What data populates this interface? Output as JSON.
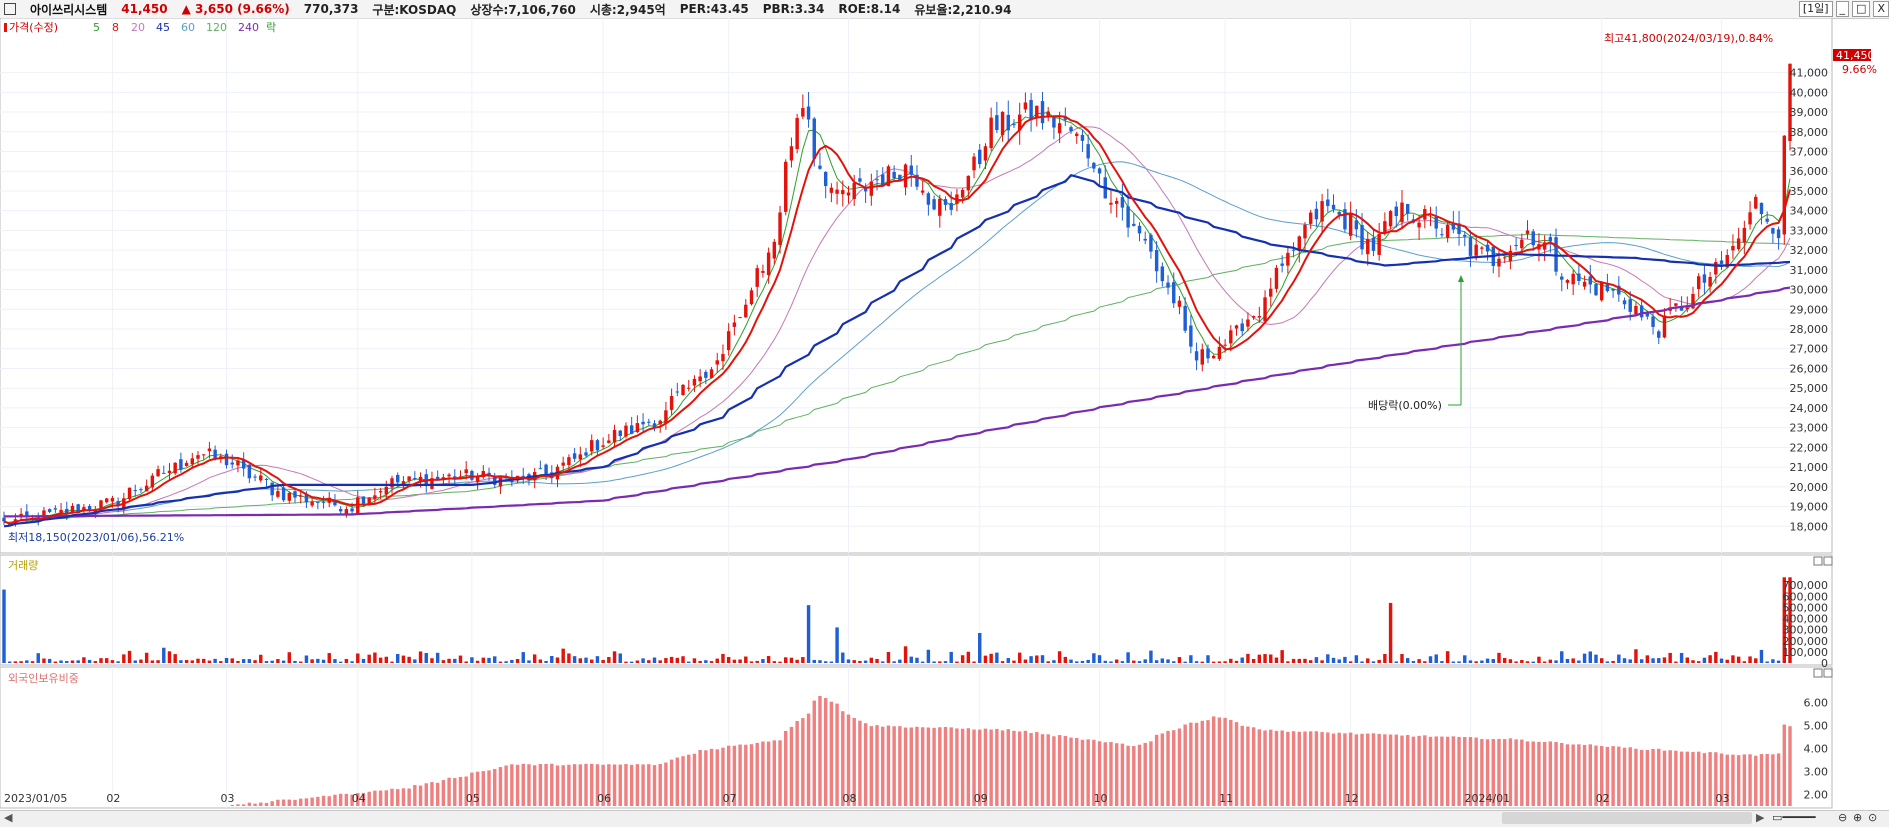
{
  "header": {
    "name": "아이쓰리시스템",
    "price": "41,450",
    "change": "▲ 3,650",
    "change_pct": "(9.66%)",
    "volume": "770,373",
    "market": "구분:KOSDAQ",
    "shares": "상장수:7,106,760",
    "mcap": "시총:2,945억",
    "per": "PER:43.45",
    "pbr": "PBR:3.34",
    "roe": "ROE:8.14",
    "reserve": "유보율:2,210.94",
    "period": "[1일]",
    "win_min": "_",
    "win_max": "□",
    "win_close": "X"
  },
  "colors": {
    "up": "#e3120b",
    "down": "#1f5fd6",
    "ma5": "#2ca02c",
    "ma8": "#e3120b",
    "ma20": "#c878b4",
    "ma45": "#1530b0",
    "ma60": "#5aa0c8",
    "ma120": "#60b060",
    "ma240": "#7a2bb0",
    "foreign": "#f08080"
  },
  "legend": {
    "price": "가격(수정)",
    "items": [
      "5",
      "8",
      "20",
      "45",
      "60",
      "120",
      "240"
    ],
    "drop": "락"
  },
  "annotations": {
    "high": "최고41,800(2024/03/19),0.84%",
    "low": "최저18,150(2023/01/06),56.21%",
    "dividend": "배당락(0.00%)",
    "last_price": "41,450",
    "last_pct": "9.66%"
  },
  "volume_panel": {
    "title": "거래량"
  },
  "foreign_panel": {
    "title": "외국인보유비중"
  },
  "chart_data": [
    {
      "type": "line",
      "title": "가격(수정)",
      "x": [
        "2023/01/05",
        "02",
        "03",
        "04",
        "05",
        "06",
        "07",
        "08",
        "09",
        "10",
        "11",
        "12",
        "2024/01",
        "02",
        "03"
      ],
      "price_ylim": [
        17000,
        42500
      ],
      "y_ticks": [
        18000,
        19000,
        20000,
        21000,
        22000,
        23000,
        24000,
        25000,
        26000,
        27000,
        28000,
        29000,
        30000,
        31000,
        32000,
        33000,
        34000,
        35000,
        36000,
        37000,
        38000,
        39000,
        40000,
        41000
      ],
      "y_tick_labels": [
        "18,000",
        "19,000",
        "20,000",
        "21,000",
        "22,000",
        "23,000",
        "24,000",
        "25,000",
        "26,000",
        "27,000",
        "28,000",
        "29,000",
        "30,000",
        "31,000",
        "32,000",
        "33,000",
        "34,000",
        "35,000",
        "36,000",
        "37,000",
        "38,000",
        "39,000",
        "40,000",
        "41,000"
      ],
      "price_anchors": [
        [
          "2023/01/06",
          18150
        ],
        [
          "2023/02/01",
          19200
        ],
        [
          "2023/02/22",
          21700
        ],
        [
          "2023/03/01",
          21300
        ],
        [
          "2023/03/15",
          19600
        ],
        [
          "2023/03/31",
          19000
        ],
        [
          "2023/04/10",
          20200
        ],
        [
          "2023/04/30",
          20600
        ],
        [
          "2023/05/10",
          20300
        ],
        [
          "2023/05/20",
          20700
        ],
        [
          "2023/06/01",
          22300
        ],
        [
          "2023/06/15",
          23500
        ],
        [
          "2023/07/01",
          26800
        ],
        [
          "2023/07/12",
          31800
        ],
        [
          "2023/07/20",
          39400
        ],
        [
          "2023/07/28",
          34500
        ],
        [
          "2023/08/07",
          35500
        ],
        [
          "2023/08/15",
          36200
        ],
        [
          "2023/08/25",
          33800
        ],
        [
          "2023/09/05",
          38200
        ],
        [
          "2023/09/15",
          39000
        ],
        [
          "2023/09/25",
          38000
        ],
        [
          "2023/10/05",
          34500
        ],
        [
          "2023/10/15",
          31500
        ],
        [
          "2023/10/25",
          26500
        ],
        [
          "2023/11/01",
          27300
        ],
        [
          "2023/11/10",
          29200
        ],
        [
          "2023/11/25",
          34500
        ],
        [
          "2023/12/07",
          32200
        ],
        [
          "2023/12/15",
          34200
        ],
        [
          "2023/12/25",
          33000
        ],
        [
          "2024/01/05",
          31500
        ],
        [
          "2024/01/15",
          33000
        ],
        [
          "2024/01/25",
          30500
        ],
        [
          "2024/02/05",
          29800
        ],
        [
          "2024/02/15",
          28000
        ],
        [
          "2024/02/25",
          30000
        ],
        [
          "2024/03/05",
          32000
        ],
        [
          "2024/03/10",
          34800
        ],
        [
          "2024/03/15",
          33000
        ],
        [
          "2024/03/18",
          37800
        ],
        [
          "2024/03/19",
          41450
        ]
      ],
      "ma45_anchors": [
        [
          "2023/01/05",
          18000
        ],
        [
          "2023/03/01",
          19700
        ],
        [
          "2023/03/15",
          20100
        ],
        [
          "2023/05/01",
          20100
        ],
        [
          "2023/06/01",
          21000
        ],
        [
          "2023/07/01",
          23600
        ],
        [
          "2023/08/01",
          28400
        ],
        [
          "2023/09/01",
          33200
        ],
        [
          "2023/09/25",
          35800
        ],
        [
          "2023/10/10",
          34600
        ],
        [
          "2023/11/10",
          32400
        ],
        [
          "2023/12/10",
          31200
        ],
        [
          "2024/01/10",
          31800
        ],
        [
          "2024/02/10",
          31600
        ],
        [
          "2024/03/01",
          31200
        ],
        [
          "2024/03/19",
          31400
        ]
      ],
      "ma240_anchors": [
        [
          "2023/01/05",
          18500
        ],
        [
          "2023/04/01",
          18600
        ],
        [
          "2023/06/01",
          19300
        ],
        [
          "2023/08/01",
          21400
        ],
        [
          "2023/10/01",
          24000
        ],
        [
          "2023/12/01",
          26300
        ],
        [
          "2024/02/01",
          28400
        ],
        [
          "2024/03/19",
          30100
        ]
      ],
      "ma120_anchors": [
        [
          "2023/01/05",
          18200
        ],
        [
          "2023/05/01",
          19800
        ],
        [
          "2023/07/01",
          22100
        ],
        [
          "2023/09/01",
          27000
        ],
        [
          "2023/10/15",
          30000
        ],
        [
          "2023/12/01",
          32400
        ],
        [
          "2024/01/15",
          32800
        ],
        [
          "2024/03/19",
          32300
        ]
      ]
    },
    {
      "type": "bar",
      "title": "거래량",
      "ylim": [
        0,
        800000
      ],
      "y_ticks": [
        0,
        100000,
        200000,
        300000,
        400000,
        500000,
        600000,
        700000
      ],
      "y_tick_labels": [
        "0",
        "100,000",
        "200,000",
        "300,000",
        "400,000",
        "500,000",
        "600,000",
        "700,000"
      ],
      "spikes": [
        [
          "2023/01/05",
          660000
        ],
        [
          "2023/07/21",
          520000
        ],
        [
          "2023/07/28",
          320000
        ],
        [
          "2023/08/15",
          150000
        ],
        [
          "2023/09/01",
          270000
        ],
        [
          "2023/12/12",
          540000
        ],
        [
          "2024/03/18",
          770000
        ],
        [
          "2024/03/19",
          770373
        ]
      ]
    },
    {
      "type": "bar",
      "title": "외국인보유비중",
      "ylim": [
        1.5,
        6.8
      ],
      "y_ticks": [
        2,
        3,
        4,
        5,
        6
      ],
      "y_tick_labels": [
        "2.00",
        "3.00",
        "4.00",
        "5.00",
        "6.00"
      ],
      "anchors": [
        [
          "2023/01/05",
          1.15
        ],
        [
          "2023/03/01",
          1.5
        ],
        [
          "2023/04/15",
          2.3
        ],
        [
          "2023/05/10",
          3.3
        ],
        [
          "2023/06/15",
          3.3
        ],
        [
          "2023/06/25",
          3.9
        ],
        [
          "2023/07/15",
          4.4
        ],
        [
          "2023/07/25",
          6.3
        ],
        [
          "2023/08/05",
          5.0
        ],
        [
          "2023/09/10",
          4.8
        ],
        [
          "2023/10/10",
          4.1
        ],
        [
          "2023/10/20",
          4.9
        ],
        [
          "2023/10/30",
          5.4
        ],
        [
          "2023/11/10",
          4.8
        ],
        [
          "2023/12/10",
          4.6
        ],
        [
          "2024/01/10",
          4.4
        ],
        [
          "2024/02/10",
          4.0
        ],
        [
          "2024/03/10",
          3.7
        ],
        [
          "2024/03/17",
          3.8
        ],
        [
          "2024/03/18",
          5.0
        ],
        [
          "2024/03/19",
          5.0
        ]
      ]
    }
  ]
}
